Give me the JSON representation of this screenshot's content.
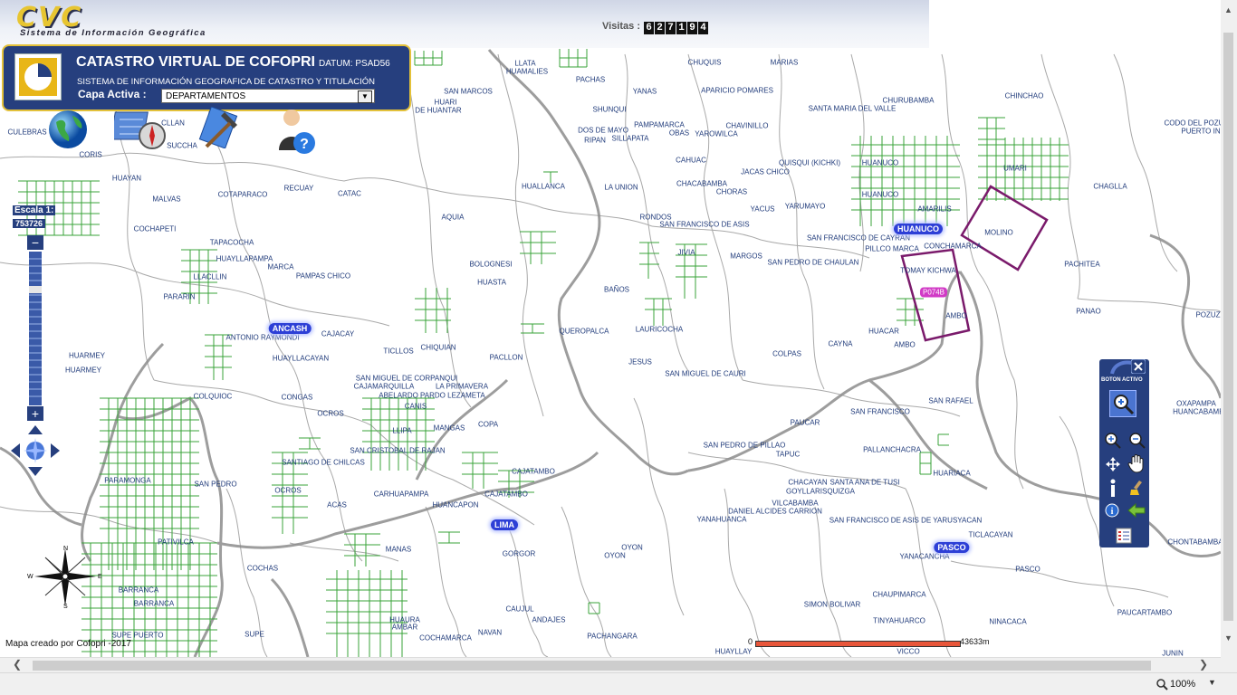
{
  "header": {
    "logo": "CVC",
    "logo_subtitle": "Sistema de Información Geográfica",
    "visits_label": "Visitas :",
    "visits_digits": [
      "6",
      "2",
      "7",
      "1",
      "9",
      "4"
    ]
  },
  "panel": {
    "title": "CATASTRO VIRTUAL DE COFOPRI",
    "datum": "DATUM: PSAD56",
    "subtitle": "SISTEMA DE INFORMACIÓN GEOGRAFICA DE CATASTRO Y TITULACIÓN",
    "capa_label": "Capa Activa :",
    "capa_value": "DEPARTAMENTOS"
  },
  "scale": {
    "label": "Escala 1:",
    "value": "753726"
  },
  "toolbox": {
    "title": "BOTON ACTIVO"
  },
  "footer": {
    "credit": "Mapa creado por Cofopri -2017",
    "scalebar_start": "0",
    "scalebar_end": "43633m",
    "zoom": "100%"
  },
  "compass": {
    "n": "N",
    "s": "S",
    "e": "E",
    "w": "W"
  },
  "departments": [
    "ANCASH",
    "HUANUCO",
    "LIMA",
    "PASCO"
  ],
  "parcel_code": "P074B",
  "place_labels": [
    [
      "LLATA",
      580,
      70
    ],
    [
      "HUAMALIES",
      582,
      79
    ],
    [
      "CHUQUIS",
      778,
      69
    ],
    [
      "MARIAS",
      866,
      69
    ],
    [
      "PACHAS",
      652,
      88
    ],
    [
      "SAN MARCOS",
      517,
      101
    ],
    [
      "HUARI",
      492,
      113
    ],
    [
      "DE HUANTAR",
      484,
      122
    ],
    [
      "YANAS",
      712,
      101
    ],
    [
      "APARICIO POMARES",
      814,
      100
    ],
    [
      "CHURUBAMBA",
      1003,
      111
    ],
    [
      "CHINCHAO",
      1131,
      106
    ],
    [
      "SHUNQUI",
      673,
      121
    ],
    [
      "SANTA MARIA DEL VALLE",
      941,
      120
    ],
    [
      "PAMPAMARCA",
      728,
      138
    ],
    [
      "CHAVINILLO",
      825,
      139
    ],
    [
      "DOS DE MAYO",
      666,
      144
    ],
    [
      "OBAS",
      750,
      147
    ],
    [
      "YAROWILCA",
      791,
      148
    ],
    [
      "RIPAN",
      657,
      155
    ],
    [
      "SILLAPATA",
      696,
      153
    ],
    [
      "CODO DEL POZUZO",
      1324,
      136
    ],
    [
      "PUERTO IN",
      1326,
      145
    ],
    [
      "CULEBRAS",
      30,
      146
    ],
    [
      "CLLAN",
      191,
      136
    ],
    [
      "SUCCHA",
      201,
      161
    ],
    [
      "CORIS",
      100,
      171
    ],
    [
      "CAHUAC",
      763,
      177
    ],
    [
      "QUISQUI (KICHKI)",
      894,
      180
    ],
    [
      "HUANUCO",
      972,
      180
    ],
    [
      "UMARI",
      1121,
      186
    ],
    [
      "JACAS CHICO",
      845,
      190
    ],
    [
      "HUAYAN",
      140,
      197
    ],
    [
      "CHACABAMBA",
      775,
      203
    ],
    [
      "CHORAS",
      808,
      212
    ],
    [
      "HUALLANCA",
      600,
      206
    ],
    [
      "LA UNION",
      686,
      207
    ],
    [
      "CHAGLLA",
      1226,
      206
    ],
    [
      "MALVAS",
      184,
      220
    ],
    [
      "COTAPARACO",
      268,
      215
    ],
    [
      "RECUAY",
      330,
      208
    ],
    [
      "CATAC",
      386,
      214
    ],
    [
      "HUANUCO",
      972,
      215
    ],
    [
      "YACUS",
      842,
      231
    ],
    [
      "YARUMAYO",
      889,
      228
    ],
    [
      "AMARILIS",
      1032,
      231
    ],
    [
      "AQUIA",
      500,
      240
    ],
    [
      "RONDOS",
      724,
      240
    ],
    [
      "SAN FRANCISCO DE ASIS",
      778,
      248
    ],
    [
      "COCHAPETI",
      171,
      253
    ],
    [
      "MOLINO",
      1103,
      257
    ],
    [
      "SAN FRANCISCO DE CAYRAN",
      948,
      263
    ],
    [
      "TAPACOCHA",
      256,
      268
    ],
    [
      "PILLCO MARCA",
      985,
      275
    ],
    [
      "CONCHAMARCA",
      1052,
      272
    ],
    [
      "JIVIA",
      758,
      279
    ],
    [
      "MARGOS",
      824,
      283
    ],
    [
      "HUAYLLAPAMPA",
      270,
      286
    ],
    [
      "BOLOGNESI",
      542,
      292
    ],
    [
      "MARCA",
      310,
      295
    ],
    [
      "SAN PEDRO DE CHAULAN",
      898,
      290
    ],
    [
      "PACHITEA",
      1195,
      292
    ],
    [
      "TOMAY KICHWA",
      1025,
      299
    ],
    [
      "PAMPAS CHICO",
      357,
      305
    ],
    [
      "LLACLLIN",
      232,
      306
    ],
    [
      "HUASTA",
      543,
      312
    ],
    [
      "BAÑOS",
      681,
      320
    ],
    [
      "PARARIN",
      198,
      328
    ],
    [
      "LAURICOCHA",
      728,
      364
    ],
    [
      "AMBO",
      1056,
      349
    ],
    [
      "PANAO",
      1202,
      344
    ],
    [
      "POZUZ",
      1334,
      348
    ],
    [
      "CAJACAY",
      373,
      369
    ],
    [
      "ANTONIO RAYMONDI",
      290,
      373
    ],
    [
      "QUEROPALCA",
      645,
      366
    ],
    [
      "HUACAR",
      976,
      366
    ],
    [
      "AMBO",
      999,
      381
    ],
    [
      "CAYNA",
      928,
      380
    ],
    [
      "COLPAS",
      869,
      391
    ],
    [
      "HUARMEY",
      96,
      393
    ],
    [
      "CHIQUIAN",
      484,
      384
    ],
    [
      "TICLLOS",
      440,
      388
    ],
    [
      "PACLLON",
      559,
      395
    ],
    [
      "HUAYLLACAYAN",
      332,
      396
    ],
    [
      "JESUS",
      707,
      400
    ],
    [
      "HUARMEY",
      92,
      409
    ],
    [
      "SAN MIGUEL DE CAURI",
      779,
      413
    ],
    [
      "SAN MIGUEL DE CORPANQUI",
      449,
      418
    ],
    [
      "CAJAMARQUILLA",
      424,
      427
    ],
    [
      "LA PRIMAVERA",
      510,
      427
    ],
    [
      "ABELARDO PARDO LEZAMETA",
      477,
      437
    ],
    [
      "COLQUIOC",
      235,
      438
    ],
    [
      "CONGAS",
      328,
      439
    ],
    [
      "CANIS",
      459,
      449
    ],
    [
      "SAN RAFAEL",
      1050,
      443
    ],
    [
      "OXAPAMPA",
      1321,
      446
    ],
    [
      "HUANCABAMBA",
      1326,
      455
    ],
    [
      "OCROS",
      365,
      457
    ],
    [
      "SAN FRANCISCO",
      972,
      455
    ],
    [
      "PAUCAR",
      889,
      467
    ],
    [
      "MANGAS",
      496,
      473
    ],
    [
      "COPA",
      539,
      469
    ],
    [
      "LLIPA",
      444,
      476
    ],
    [
      "SAN PEDRO DE PILLAO",
      822,
      492
    ],
    [
      "PALLANCHACRA",
      985,
      497
    ],
    [
      "SAN CRISTOBAL DE RAJAN",
      439,
      498
    ],
    [
      "TAPUC",
      870,
      502
    ],
    [
      "SANTIAGO DE CHILCAS",
      357,
      511
    ],
    [
      "CAJATAMBO",
      589,
      521
    ],
    [
      "HUARIACA",
      1051,
      523
    ],
    [
      "PARAMONGA",
      141,
      531
    ],
    [
      "SAN PEDRO",
      238,
      535
    ],
    [
      "CHACAYAN",
      892,
      533
    ],
    [
      "SANTA ANA DE TUSI",
      955,
      533
    ],
    [
      "OCROS",
      318,
      542
    ],
    [
      "GOYLLARISQUIZGA",
      906,
      543
    ],
    [
      "CARHUAPAMPA",
      443,
      546
    ],
    [
      "CAJATAMBO",
      559,
      546
    ],
    [
      "VILCABAMBA",
      878,
      556
    ],
    [
      "ACAS",
      372,
      558
    ],
    [
      "HUANCAPON",
      503,
      558
    ],
    [
      "DANIEL ALCIDES CARRION",
      856,
      565
    ],
    [
      "YANAHUANCA",
      797,
      574
    ],
    [
      "SAN FRANCISCO DE ASIS DE YARUSYACAN",
      1000,
      575
    ],
    [
      "TICLACAYAN",
      1094,
      591
    ],
    [
      "PATIVILCA",
      194,
      599
    ],
    [
      "CHONTABAMBA",
      1320,
      599
    ],
    [
      "MANAS",
      440,
      607
    ],
    [
      "GORGOR",
      573,
      612
    ],
    [
      "OYON",
      698,
      605
    ],
    [
      "OYON",
      679,
      614
    ],
    [
      "YANACANCHA",
      1021,
      615
    ],
    [
      "COCHAS",
      290,
      628
    ],
    [
      "PASCO",
      1135,
      629
    ],
    [
      "BARRANCA",
      153,
      652
    ],
    [
      "CHAUPIMARCA",
      993,
      657
    ],
    [
      "BARRANCA",
      170,
      667
    ],
    [
      "SIMON BOLIVAR",
      919,
      668
    ],
    [
      "CAUJUL",
      574,
      673
    ],
    [
      "PAUCARTAMBO",
      1264,
      677
    ],
    [
      "HUAURA",
      447,
      685
    ],
    [
      "ANDAJES",
      606,
      685
    ],
    [
      "TINYAHUARCO",
      993,
      686
    ],
    [
      "NINACACA",
      1113,
      687
    ],
    [
      "AMBAR",
      447,
      693
    ],
    [
      "SUPE PUERTO",
      152,
      702
    ],
    [
      "SUPE",
      281,
      701
    ],
    [
      "NAVAN",
      541,
      699
    ],
    [
      "PACHANGARA",
      676,
      703
    ],
    [
      "COCHAMARCA",
      492,
      705
    ],
    [
      "HUAYLLAY",
      810,
      720
    ],
    [
      "VICCO",
      1003,
      720
    ],
    [
      "JUNIN",
      1295,
      722
    ]
  ]
}
